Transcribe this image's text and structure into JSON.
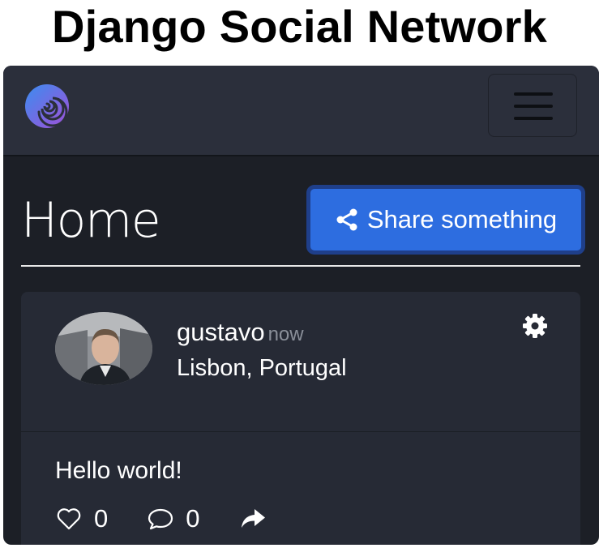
{
  "page": {
    "heading": "Django Social Network"
  },
  "navbar": {
    "logo_icon": "swirl-logo-icon",
    "menu_icon": "hamburger-menu-icon",
    "background": "#2b2f3b"
  },
  "main": {
    "title": "Home",
    "share_button": {
      "label": "Share something",
      "icon": "share-icon",
      "color": "#2d6de0"
    }
  },
  "posts": [
    {
      "author": "gustavo",
      "time": "now",
      "location": "Lisbon, Portugal",
      "text": "Hello world!",
      "likes": "0",
      "comments": "0",
      "settings_icon": "gear-icon",
      "like_icon": "heart-icon",
      "comment_icon": "comment-icon",
      "share_icon": "share-arrow-icon"
    }
  ]
}
